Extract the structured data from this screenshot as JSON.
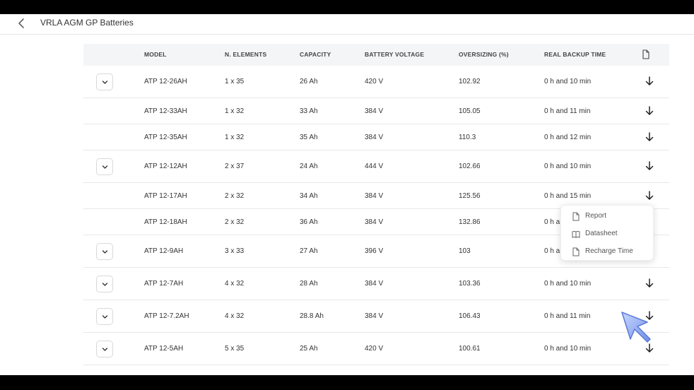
{
  "header": {
    "title": "VRLA AGM GP Batteries"
  },
  "table": {
    "columns": [
      "MODEL",
      "N. ELEMENTS",
      "CAPACITY",
      "BATTERY VOLTAGE",
      "OVERSIZING (%)",
      "REAL BACKUP TIME"
    ],
    "rows": [
      {
        "model": "ATP 12-26AH",
        "elements": "1 x 35",
        "capacity": "26 Ah",
        "voltage": "420 V",
        "oversizing": "102.92",
        "backup": "0 h and 10 min",
        "expandable": true
      },
      {
        "model": "ATP 12-33AH",
        "elements": "1 x 32",
        "capacity": "33 Ah",
        "voltage": "384 V",
        "oversizing": "105.05",
        "backup": "0 h and 11 min",
        "expandable": false
      },
      {
        "model": "ATP 12-35AH",
        "elements": "1 x 32",
        "capacity": "35 Ah",
        "voltage": "384 V",
        "oversizing": "110.3",
        "backup": "0 h and 12 min",
        "expandable": false
      },
      {
        "model": "ATP 12-12AH",
        "elements": "2 x 37",
        "capacity": "24 Ah",
        "voltage": "444 V",
        "oversizing": "102.66",
        "backup": "0 h and 10 min",
        "expandable": true
      },
      {
        "model": "ATP 12-17AH",
        "elements": "2 x 32",
        "capacity": "34 Ah",
        "voltage": "384 V",
        "oversizing": "125.56",
        "backup": "0 h and 15 min",
        "expandable": false
      },
      {
        "model": "ATP 12-18AH",
        "elements": "2 x 32",
        "capacity": "36 Ah",
        "voltage": "384 V",
        "oversizing": "132.86",
        "backup": "0 h a",
        "expandable": false
      },
      {
        "model": "ATP 12-9AH",
        "elements": "3 x 33",
        "capacity": "27 Ah",
        "voltage": "396 V",
        "oversizing": "103",
        "backup": "0 h a",
        "expandable": true
      },
      {
        "model": "ATP 12-7AH",
        "elements": "4 x 32",
        "capacity": "28 Ah",
        "voltage": "384 V",
        "oversizing": "103.36",
        "backup": "0 h and 10 min",
        "expandable": true
      },
      {
        "model": "ATP 12-7.2AH",
        "elements": "4 x 32",
        "capacity": "28.8 Ah",
        "voltage": "384 V",
        "oversizing": "106.43",
        "backup": "0 h and 11 min",
        "expandable": true
      },
      {
        "model": "ATP 12-5AH",
        "elements": "5 x 35",
        "capacity": "25 Ah",
        "voltage": "420 V",
        "oversizing": "100.61",
        "backup": "0 h and 10 min",
        "expandable": true
      }
    ]
  },
  "download_menu": {
    "items": [
      {
        "label": "Report",
        "icon": "file-icon"
      },
      {
        "label": "Datasheet",
        "icon": "book-icon"
      },
      {
        "label": "Recharge Time",
        "icon": "file-icon"
      }
    ]
  },
  "icons": {
    "back": "chevron-left-icon",
    "expand": "chevron-down-icon",
    "download": "arrow-down-icon",
    "header_file": "file-icon"
  }
}
